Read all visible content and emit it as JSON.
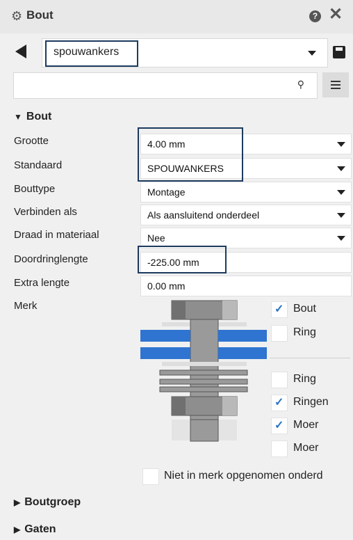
{
  "window": {
    "title": "Bout",
    "help_icon": "?",
    "close_icon": "✕"
  },
  "preset": {
    "value": "spouwankers"
  },
  "search": {
    "placeholder": "",
    "icon": "search-icon"
  },
  "section_main": {
    "label": "Bout",
    "expanded": true
  },
  "properties": [
    {
      "label": "Grootte",
      "value": "4.00 mm",
      "type": "dropdown"
    },
    {
      "label": "Standaard",
      "value": "SPOUWANKERS",
      "type": "dropdown"
    },
    {
      "label": "Bouttype",
      "value": "Montage",
      "type": "dropdown"
    },
    {
      "label": "Verbinden als",
      "value": "Als aansluitend onderdeel",
      "type": "dropdown"
    },
    {
      "label": "Draad in materiaal",
      "value": "Nee",
      "type": "dropdown"
    },
    {
      "label": "Doordringlengte",
      "value": "-225.00 mm",
      "type": "text"
    },
    {
      "label": "Extra lengte",
      "value": "0.00 mm",
      "type": "text"
    }
  ],
  "merk": {
    "label": "Merk",
    "checks": [
      {
        "label": "Bout",
        "checked": true
      },
      {
        "label": "Ring",
        "checked": false
      },
      {
        "label": "Ring",
        "checked": false
      },
      {
        "label": "Ringen",
        "checked": true
      },
      {
        "label": "Moer",
        "checked": true
      },
      {
        "label": "Moer",
        "checked": false
      }
    ],
    "not_in_mark": {
      "label": "Niet in merk opgenomen onderd",
      "checked": false
    }
  },
  "sections_collapsed": [
    {
      "label": "Boutgroep"
    },
    {
      "label": "Gaten"
    }
  ],
  "colors": {
    "accent": "#2a73c4",
    "highlight_border": "#1c3a5e",
    "plate_blue": "#2f74d0"
  }
}
